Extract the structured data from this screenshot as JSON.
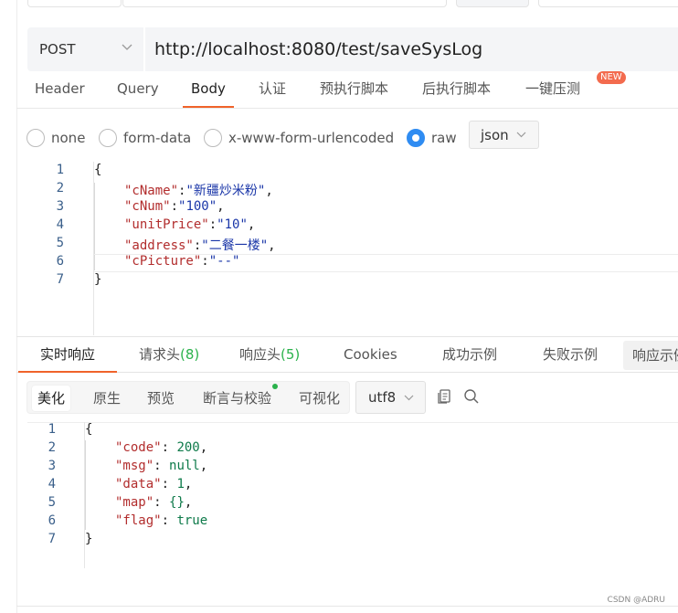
{
  "request": {
    "method": "POST",
    "url": "http://localhost:8080/test/saveSysLog",
    "tabs": [
      "Header",
      "Query",
      "Body",
      "认证",
      "预执行脚本",
      "后执行脚本",
      "一键压测"
    ],
    "active_tab": "Body",
    "new_badge": "NEW"
  },
  "body_types": {
    "options": [
      "none",
      "form-data",
      "x-www-form-urlencoded",
      "raw"
    ],
    "selected": "raw",
    "format": "json"
  },
  "request_body": {
    "line_numbers": [
      "1",
      "2",
      "3",
      "4",
      "5",
      "6",
      "7"
    ],
    "lines": [
      {
        "pre": "{"
      },
      {
        "key": "\"cName\"",
        "sep": ":",
        "val": "\"新疆炒米粉\"",
        "post": ","
      },
      {
        "key": "\"cNum\"",
        "sep": ":",
        "val": "\"100\"",
        "post": ","
      },
      {
        "key": "\"unitPrice\"",
        "sep": ":",
        "val": "\"10\"",
        "post": ","
      },
      {
        "key": "\"address\"",
        "sep": ":",
        "val": "\"二餐一楼\"",
        "post": ","
      },
      {
        "key": "\"cPicture\"",
        "sep": ":",
        "val": "\"--\"",
        "post": ""
      },
      {
        "pre": "}"
      }
    ]
  },
  "response": {
    "tabs": [
      {
        "label": "实时响应"
      },
      {
        "label": "请求头",
        "count": "(8)"
      },
      {
        "label": "响应头",
        "count": "(5)"
      },
      {
        "label": "Cookies"
      },
      {
        "label": "成功示例"
      },
      {
        "label": "失败示例"
      },
      {
        "label": "响应示例"
      }
    ],
    "active_tab": "实时响应",
    "view_modes": [
      "美化",
      "原生",
      "预览",
      "断言与校验",
      "可视化"
    ],
    "active_view": "美化",
    "encoding": "utf8",
    "line_numbers": [
      "1",
      "2",
      "3",
      "4",
      "5",
      "6",
      "7"
    ],
    "lines": [
      {
        "pre": "{"
      },
      {
        "key": "\"code\"",
        "sep": ": ",
        "val": "200",
        "post": ","
      },
      {
        "key": "\"msg\"",
        "sep": ": ",
        "val": "null",
        "post": ","
      },
      {
        "key": "\"data\"",
        "sep": ": ",
        "val": "1",
        "post": ","
      },
      {
        "key": "\"map\"",
        "sep": ": ",
        "val": "{}",
        "post": ","
      },
      {
        "key": "\"flag\"",
        "sep": ": ",
        "val": "true",
        "post": ""
      },
      {
        "pre": "}"
      }
    ]
  },
  "watermark": "CSDN @ADRU",
  "colors": {
    "accent": "#f0632a",
    "radio_checked": "#2f8cf2",
    "count_green": "#2bb24c",
    "json_key": "#b22d2d",
    "json_string": "#1a36a8",
    "json_literal": "#0e7a4a"
  }
}
